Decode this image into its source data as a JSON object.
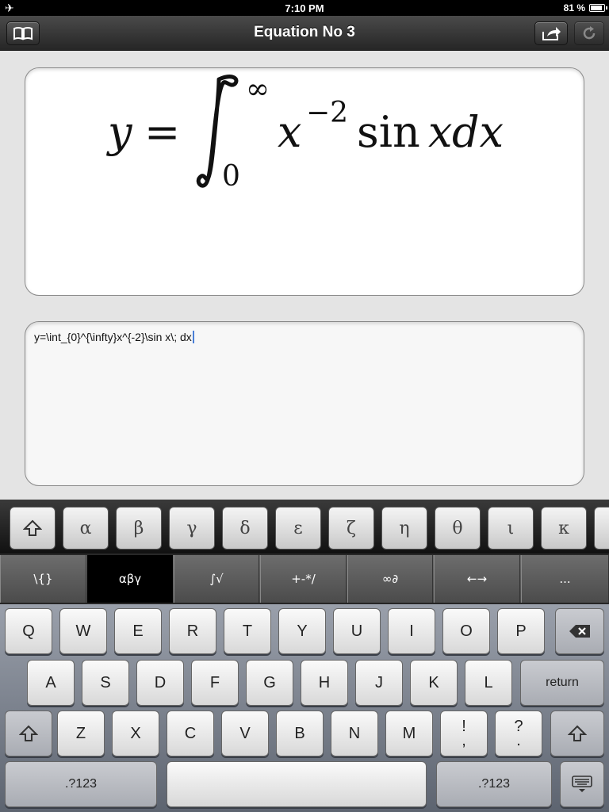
{
  "status": {
    "time": "7:10 PM",
    "battery": "81 %"
  },
  "navbar": {
    "title": "Equation No 3"
  },
  "equation": {
    "rendered": "y = ∫₀^∞ x⁻² sin x dx",
    "lhs": "y",
    "equals": "=",
    "lower": "0",
    "upper": "∞",
    "base": "x",
    "exponent": "−2",
    "func": "sin",
    "var": "x",
    "diff": "dx"
  },
  "editor": {
    "source": "y=\\int_{0}^{\\infty}x^{-2}\\sin x\\; dx"
  },
  "keyboard": {
    "greek": [
      "α",
      "β",
      "γ",
      "δ",
      "ε",
      "ζ",
      "η",
      "θ",
      "ι",
      "κ"
    ],
    "tabs": [
      "\\{}",
      "αβγ",
      "∫√",
      "+-*/",
      "∞∂",
      "←→",
      "..."
    ],
    "row1": [
      "Q",
      "W",
      "E",
      "R",
      "T",
      "Y",
      "U",
      "I",
      "O",
      "P"
    ],
    "row2": [
      "A",
      "S",
      "D",
      "F",
      "G",
      "H",
      "J",
      "K",
      "L"
    ],
    "row3": [
      "Z",
      "X",
      "C",
      "V",
      "B",
      "N",
      "M"
    ],
    "punct1": [
      "!",
      ","
    ],
    "punct2": [
      "?",
      "."
    ],
    "return_label": "return",
    "numbers_label": ".?123"
  }
}
